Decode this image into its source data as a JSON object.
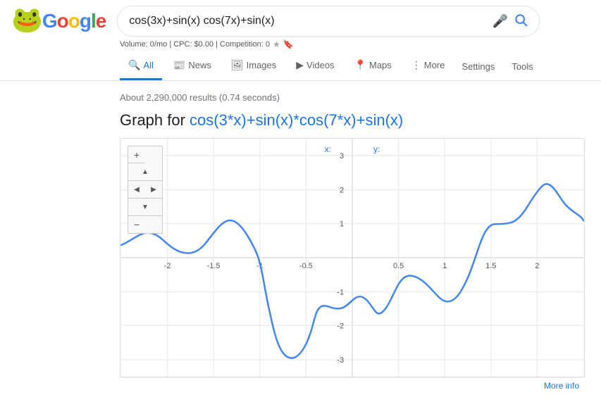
{
  "logo": {
    "letters": [
      "G",
      "o",
      "o",
      "g",
      "l",
      "e"
    ]
  },
  "search": {
    "value": "cos(3x)+sin(x) cos(7x)+sin(x)",
    "placeholder": "Search"
  },
  "volume_bar": {
    "text": "Volume: 0/mo | CPC: $0.00 | Competition: 0"
  },
  "nav": {
    "tabs": [
      {
        "id": "all",
        "label": "All",
        "active": true,
        "icon": "🔍"
      },
      {
        "id": "news",
        "label": "News",
        "active": false,
        "icon": "📰"
      },
      {
        "id": "images",
        "label": "Images",
        "active": false,
        "icon": "🖼"
      },
      {
        "id": "videos",
        "label": "Videos",
        "active": false,
        "icon": "▶"
      },
      {
        "id": "maps",
        "label": "Maps",
        "active": false,
        "icon": "📍"
      },
      {
        "id": "more",
        "label": "More",
        "active": false,
        "icon": "⋮"
      }
    ],
    "settings": "Settings",
    "tools": "Tools"
  },
  "results": {
    "count": "About 2,290,000 results (0.74 seconds)"
  },
  "graph": {
    "heading_prefix": "Graph for ",
    "formula_display": "cos(3*x)+sin(x)*cos(7*x)+sin(x)",
    "coord_x_label": "x:",
    "coord_y_label": "y:",
    "more_info": "More info",
    "controls": {
      "zoom_in": "+",
      "zoom_out": "−",
      "up": "▲",
      "down": "▼",
      "left": "◀",
      "right": "▶"
    },
    "x_axis_labels": [
      "-2",
      "-1.5",
      "-1",
      "-0.5",
      "0.5",
      "1",
      "1.5",
      "2"
    ],
    "y_axis_labels": [
      "-3",
      "-2",
      "-1",
      "1",
      "2",
      "3"
    ]
  }
}
